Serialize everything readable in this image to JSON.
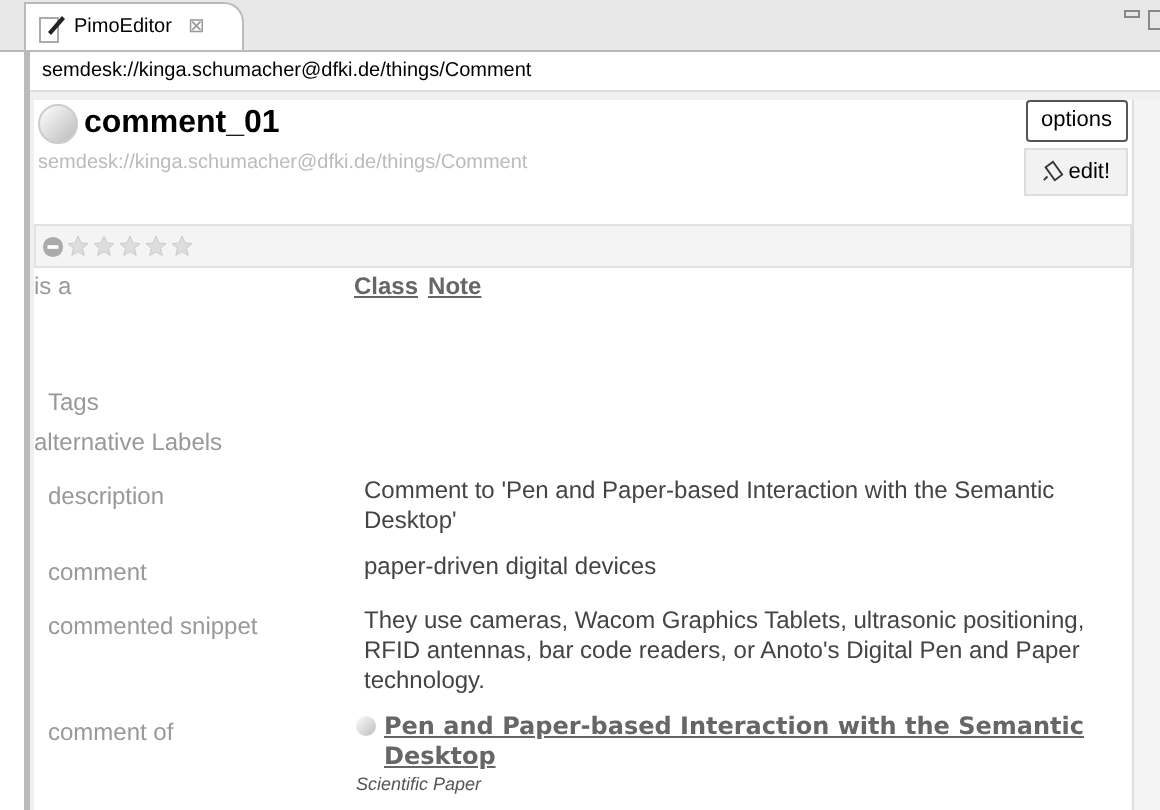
{
  "tab": {
    "title": "PimoEditor",
    "close": "⊠"
  },
  "address": "semdesk://kinga.schumacher@dfki.de/things/Comment",
  "resource": {
    "title": "comment_01",
    "uri": "semdesk://kinga.schumacher@dfki.de/things/Comment",
    "options": "options",
    "edit": "edit!",
    "stars": 0
  },
  "is_a": {
    "label": "is a",
    "classes": [
      "Class",
      "Note"
    ]
  },
  "tags": {
    "label": "Tags"
  },
  "alt_labels": {
    "label": "alternative Labels"
  },
  "properties": [
    {
      "kind": "text",
      "label": "description",
      "value": "Comment to 'Pen and Paper-based Interaction with the Semantic Desktop'"
    },
    {
      "kind": "text",
      "label": "comment",
      "value": "paper-driven digital devices"
    },
    {
      "kind": "text",
      "label": "commented snippet",
      "value": "They use cameras, Wacom Graphics Tablets, ultrasonic positioning, RFID antennas, bar code readers, or Anoto's Digital Pen and Paper technology."
    },
    {
      "kind": "link",
      "label": "comment of",
      "value": "Pen and Paper-based Interaction with the Semantic Desktop",
      "type": "Scientific Paper"
    }
  ]
}
